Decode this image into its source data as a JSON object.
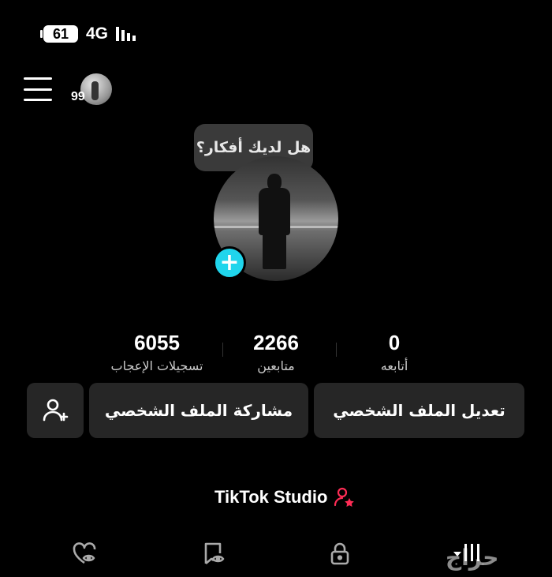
{
  "status_bar": {
    "battery": "61",
    "network": "4G"
  },
  "header": {
    "story_count": "99"
  },
  "bubble": {
    "text": "هل لديك أفكار؟"
  },
  "stats": {
    "following": {
      "value": "0",
      "label": "أتابعه"
    },
    "followers": {
      "value": "2266",
      "label": "متابعين"
    },
    "likes": {
      "value": "6055",
      "label": "تسجيلات الإعجاب"
    }
  },
  "actions": {
    "edit_profile": "تعديل الملف الشخصي",
    "share_profile": "مشاركة الملف الشخصي"
  },
  "studio": {
    "label": "TikTok Studio"
  },
  "tabs": [
    "grid-tab",
    "lock-tab",
    "saved-tab",
    "liked-tab"
  ],
  "watermark": {
    "text": "حراج"
  },
  "colors": {
    "accent": "#20d5ec",
    "studio_icon": "#fe2c55",
    "button_bg": "#262626"
  }
}
